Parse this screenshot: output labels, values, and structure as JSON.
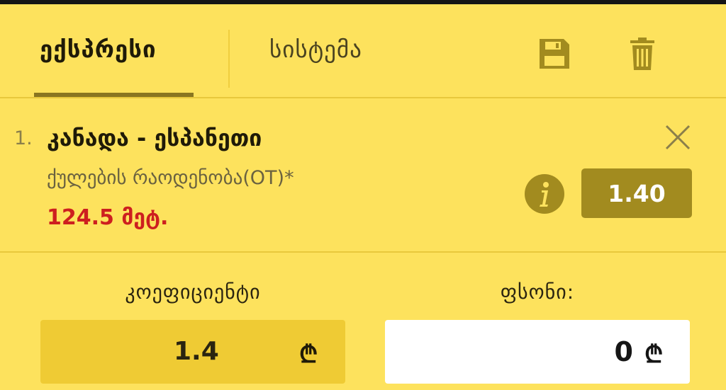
{
  "tabs": {
    "express": "ექსპრესი",
    "system": "სისტემა"
  },
  "icons": {
    "save": "save-icon",
    "delete": "trash-icon",
    "close": "close-icon",
    "info": "info-icon"
  },
  "bet": {
    "number": "1.",
    "match": "კანადა - ესპანეთი",
    "market": "ქულების რაოდენობა(OT)*",
    "selection": "124.5 მეტ.",
    "odds": "1.40"
  },
  "summary": {
    "coefficient_label": "კოეფიციენტი",
    "coefficient_value": "1.4",
    "stake_label": "ფსონი:",
    "stake_value": "0",
    "currency_symbol": "₾"
  },
  "colors": {
    "background": "#fde25d",
    "accent": "#a28b1f",
    "selection_red": "#cd1f1f"
  }
}
